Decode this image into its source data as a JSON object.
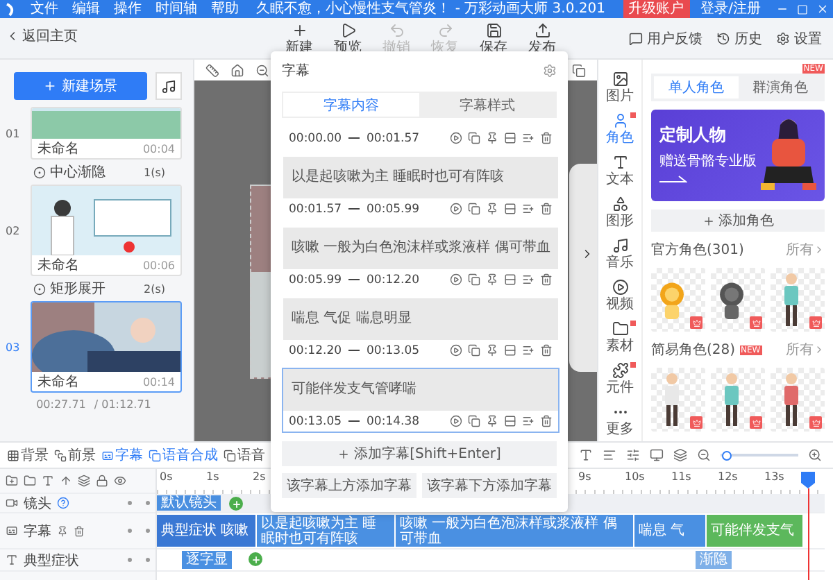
{
  "menu": [
    "文件",
    "编辑",
    "操作",
    "时间轴",
    "帮助"
  ],
  "window_title": "久眠不愈，小心慢性支气管炎！ - 万彩动画大师 3.0.201",
  "upgrade_button": "升级账户",
  "login_link": "登录/注册",
  "back_link": "返回主页",
  "toolbar": [
    {
      "kind": "new",
      "label": "新建",
      "disabled": false
    },
    {
      "kind": "preview",
      "label": "预览",
      "disabled": false
    },
    {
      "kind": "undo",
      "label": "撤销",
      "disabled": true
    },
    {
      "kind": "redo",
      "label": "恢复",
      "disabled": true
    },
    {
      "kind": "save",
      "label": "保存",
      "disabled": false
    },
    {
      "kind": "publish",
      "label": "发布",
      "disabled": false
    }
  ],
  "header_actions": [
    {
      "kind": "feedback",
      "label": "用户反馈"
    },
    {
      "kind": "history",
      "label": "历史"
    },
    {
      "kind": "settings",
      "label": "设置"
    }
  ],
  "scene_panel": {
    "new_scene_button": "新建场景",
    "scenes": [
      {
        "number": "01",
        "kind": "lungs",
        "name": "未命名",
        "duration": "00:04",
        "selected": false,
        "transition": {
          "name": "中心渐隐",
          "duration": "1(s)"
        }
      },
      {
        "number": "02",
        "kind": "clinic",
        "name": "未命名",
        "duration": "00:06",
        "selected": false,
        "transition": {
          "name": "矩形展开",
          "duration": "2(s)"
        }
      },
      {
        "number": "03",
        "kind": "bedroom",
        "name": "未命名",
        "duration": "00:14",
        "selected": true
      }
    ],
    "current_time": "00:27.71",
    "total_time": "/ 01:12.71"
  },
  "side_tools": [
    {
      "kind": "image",
      "label": "图片",
      "selected": false,
      "badge": false
    },
    {
      "kind": "character",
      "label": "角色",
      "selected": true,
      "badge": true
    },
    {
      "kind": "text",
      "label": "文本",
      "selected": false,
      "badge": false
    },
    {
      "kind": "shape",
      "label": "图形",
      "selected": false,
      "badge": false
    },
    {
      "kind": "music",
      "label": "音乐",
      "selected": false,
      "badge": false
    },
    {
      "kind": "video",
      "label": "视频",
      "selected": false,
      "badge": false
    },
    {
      "kind": "material",
      "label": "素材",
      "selected": false,
      "badge": true
    },
    {
      "kind": "component",
      "label": "元件",
      "selected": false,
      "badge": true
    },
    {
      "kind": "more",
      "label": "更多",
      "selected": false,
      "badge": false
    }
  ],
  "character_panel": {
    "tabs": [
      {
        "label": "单人角色",
        "selected": true
      },
      {
        "label": "群演角色",
        "selected": false,
        "badge": "NEW"
      }
    ],
    "banner": {
      "title": "定制人物",
      "subtitle": "赠送骨骼专业版"
    },
    "add_button": "添加角色",
    "sections": [
      {
        "title": "官方角色(301)",
        "more": "所有",
        "tiles": [
          {
            "kind": "animal"
          },
          {
            "kind": "animal"
          },
          {
            "kind": "person"
          }
        ]
      },
      {
        "title": "简易角色(28)",
        "badge": "NEW",
        "more": "所有",
        "tiles": [
          {
            "kind": "person"
          },
          {
            "kind": "person"
          },
          {
            "kind": "person"
          }
        ]
      }
    ]
  },
  "bottom_tabs": [
    {
      "kind": "background",
      "label": "背景",
      "active": false
    },
    {
      "kind": "foreground",
      "label": "前景",
      "active": false
    },
    {
      "kind": "subtitle",
      "label": "字幕",
      "active": true
    },
    {
      "kind": "tts",
      "label": "语音合成",
      "active": true
    },
    {
      "kind": "asr",
      "label": "语音",
      "active": false
    }
  ],
  "zoom": {
    "level": 0.03
  },
  "timeline": {
    "ruler_start": [
      "0s",
      "1s",
      "2s"
    ],
    "ruler_end": [
      "9s",
      "10s",
      "11s",
      "12s",
      "13s"
    ],
    "tracks": [
      {
        "kind": "camera",
        "label": "镜头"
      },
      {
        "kind": "subtitle",
        "label": "字幕"
      },
      {
        "kind": "text",
        "label": "典型症状"
      }
    ],
    "camera_clips": [
      {
        "label": "默认镜头"
      }
    ],
    "subtitle_segments": [
      {
        "text": "典型症状 咳嗽",
        "selected": false
      },
      {
        "text": "以是起咳嗽为主 睡眠时也可有阵咳",
        "selected": false
      },
      {
        "text": "咳嗽 一般为白色泡沫样或浆液样 偶可带血",
        "selected": false
      },
      {
        "text": "喘息 气",
        "selected": false
      },
      {
        "text": "可能伴发支气",
        "selected": true
      }
    ],
    "text_clips": [
      {
        "label": "逐字显"
      },
      {
        "label": "渐隐"
      }
    ]
  },
  "subtitle_dialog": {
    "title": "字幕",
    "tabs": [
      {
        "label": "字幕内容",
        "selected": true
      },
      {
        "label": "字幕样式",
        "selected": false
      }
    ],
    "entries": [
      {
        "start": "00:00.00",
        "end": "00:01.57",
        "selected": false
      },
      {
        "text": "以是起咳嗽为主 睡眠时也可有阵咳",
        "start": "00:01.57",
        "end": "00:05.99",
        "selected": false
      },
      {
        "text": "咳嗽 一般为白色泡沫样或浆液样 偶可带血",
        "start": "00:05.99",
        "end": "00:12.20",
        "selected": false
      },
      {
        "text": "喘息 气促 喘息明显",
        "start": "00:12.20",
        "end": "00:13.05",
        "selected": false
      },
      {
        "text": "可能伴发支气管哮喘",
        "start": "00:13.05",
        "end": "00:14.38",
        "selected": true
      }
    ],
    "add_button": "添加字幕[Shift+Enter]",
    "insert_above": "该字幕上方添加字幕",
    "insert_below": "该字幕下方添加字幕"
  }
}
